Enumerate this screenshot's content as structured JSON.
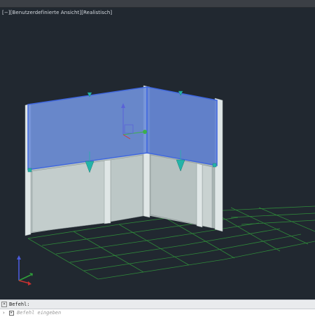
{
  "viewport": {
    "label": "[−][Benutzerdefinierte Ansicht][Realistisch]"
  },
  "command_line": {
    "history_label": "Befehl:",
    "input_placeholder": "Befehl eingeben"
  },
  "icons": {
    "ucs": "ucs-axis-icon",
    "grips": "grip-arrow-icon",
    "gizmo": "move-gizmo-icon"
  },
  "colors": {
    "background": "#212830",
    "selection_fill": "#6f8fd8",
    "selection_edge": "#4a6fe0",
    "grid": "#2f8a3a",
    "wall_front": "#b7c2c2",
    "wall_light": "#dfe5e5"
  }
}
